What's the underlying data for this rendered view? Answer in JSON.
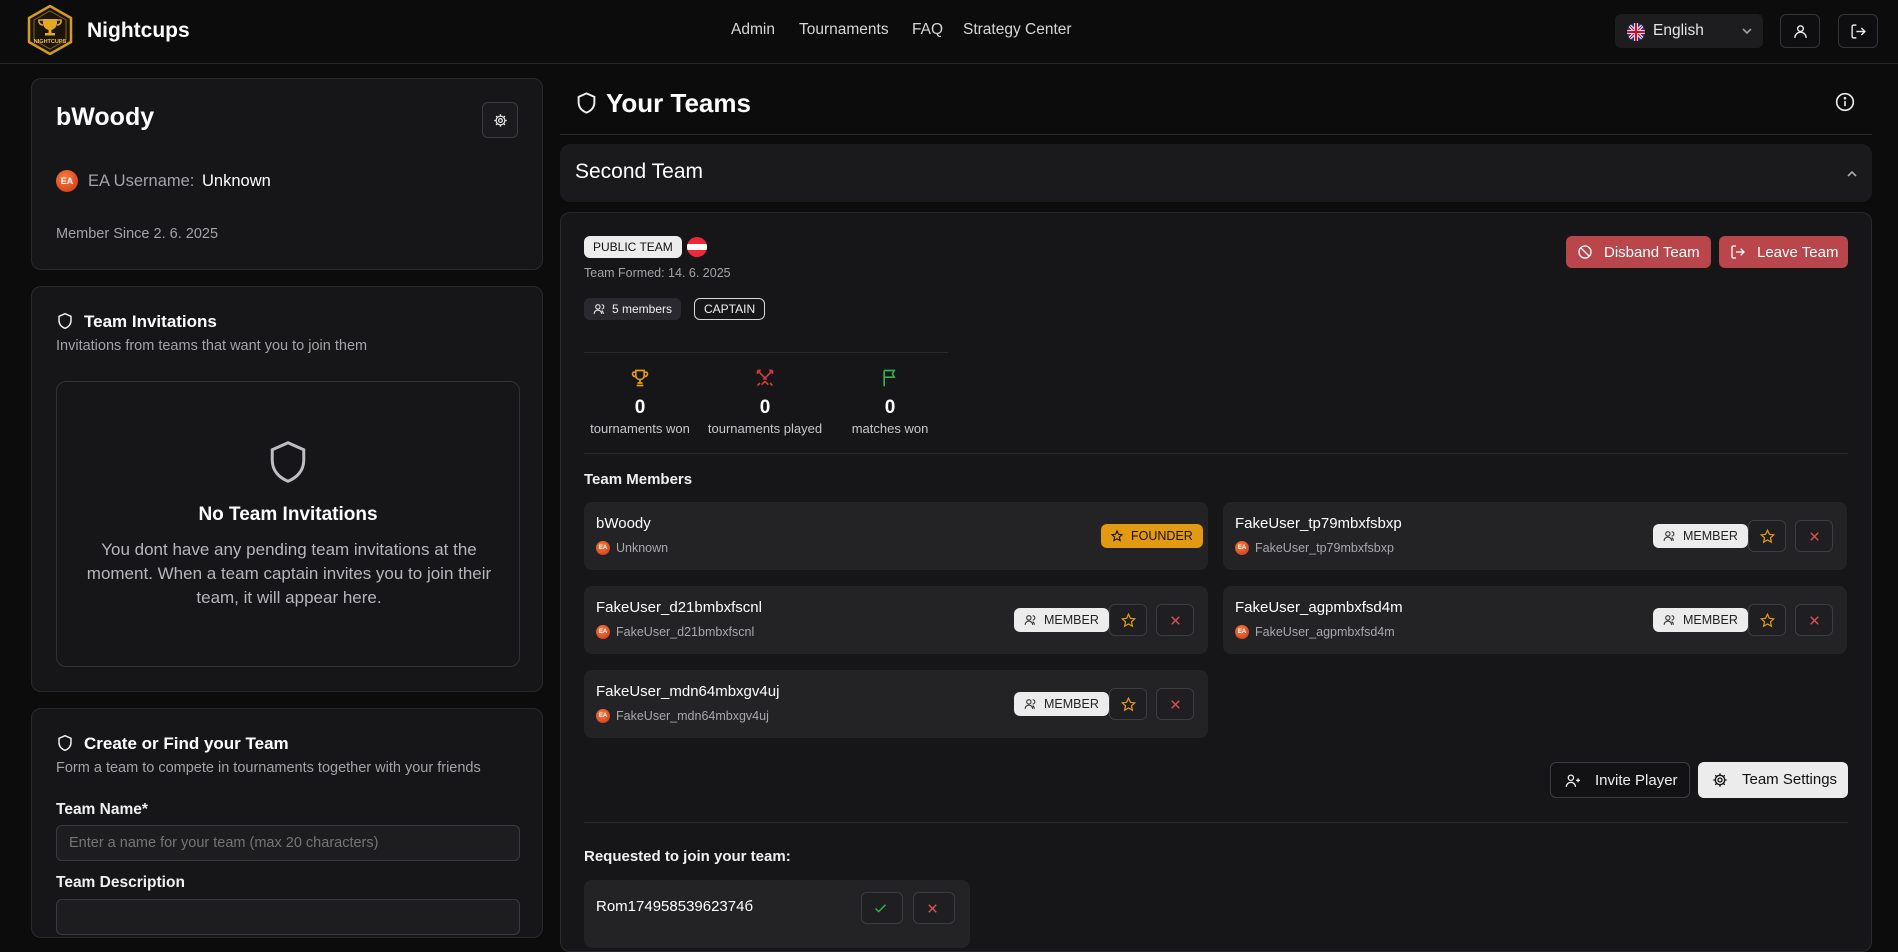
{
  "header": {
    "brand": "Nightcups",
    "logo_text": "NIGHTCUPS",
    "nav": [
      "Admin",
      "Tournaments",
      "FAQ",
      "Strategy Center"
    ],
    "language": "English",
    "icons": [
      "user-icon",
      "logout-icon"
    ]
  },
  "profile": {
    "name": "bWoody",
    "ea_label": "EA Username:",
    "ea_value": "Unknown",
    "member_since": "Member Since 2. 6. 2025"
  },
  "invitations": {
    "title": "Team Invitations",
    "subtitle": "Invitations from teams that want you to join them",
    "empty_title": "No Team Invitations",
    "empty_text": "You dont have any pending team invitations at the moment. When a team captain invites you to join their team, it will appear here."
  },
  "create_team": {
    "title": "Create or Find your Team",
    "subtitle": "Form a team to compete in tournaments together with your friends",
    "name_label": "Team Name*",
    "name_placeholder": "Enter a name for your team (max 20 characters)",
    "desc_label": "Team Description"
  },
  "teams": {
    "title": "Your Teams",
    "team_name": "Second Team",
    "visibility": "PUBLIC TEAM",
    "formed": "Team Formed: 14. 6. 2025",
    "members_count": "5 members",
    "role": "CAPTAIN",
    "disband_label": "Disband Team",
    "leave_label": "Leave Team",
    "stats": [
      {
        "value": "0",
        "label": "tournaments won",
        "icon": "trophy-icon"
      },
      {
        "value": "0",
        "label": "tournaments played",
        "icon": "swords-icon"
      },
      {
        "value": "0",
        "label": "matches won",
        "icon": "flag-icon"
      }
    ],
    "members_title": "Team Members",
    "members": [
      {
        "name": "bWoody",
        "ea": "Unknown",
        "role": "FOUNDER"
      },
      {
        "name": "FakeUser_tp79mbxfsbxp",
        "ea": "FakeUser_tp79mbxfsbxp",
        "role": "MEMBER"
      },
      {
        "name": "FakeUser_d21bmbxfscnl",
        "ea": "FakeUser_d21bmbxfscnl",
        "role": "MEMBER"
      },
      {
        "name": "FakeUser_agpmbxfsd4m",
        "ea": "FakeUser_agpmbxfsd4m",
        "role": "MEMBER"
      },
      {
        "name": "FakeUser_mdn64mbxgv4uj",
        "ea": "FakeUser_mdn64mbxgv4uj",
        "role": "MEMBER"
      }
    ],
    "invite_label": "Invite Player",
    "settings_label": "Team Settings",
    "requests_title": "Requested to join your team:",
    "requests": [
      {
        "name": "Rom17495853962374б"
      }
    ]
  },
  "colors": {
    "background": "#0c0c0d",
    "card": "#161618",
    "danger": "#b8464b",
    "founder": "#e29a12",
    "trophy": "#e29a12",
    "swords": "#d23b3b",
    "flag": "#2fb04a"
  }
}
